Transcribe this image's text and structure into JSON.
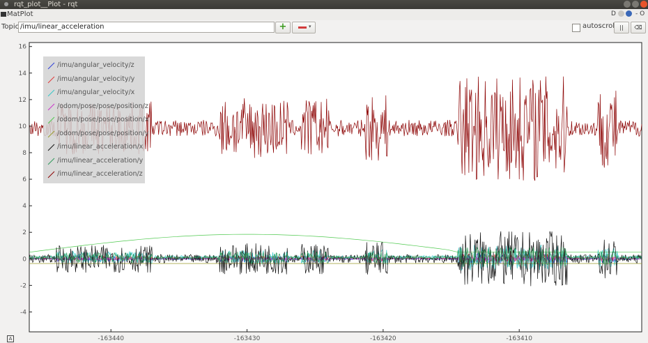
{
  "window": {
    "title": "rqt_plot__Plot - rqt"
  },
  "menubar": {
    "title": "MatPlot",
    "right_glyphs": "D",
    "right_dash": "- O"
  },
  "toolbar": {
    "topic_label": "Topic",
    "topic_value": "/imu/linear_acceleration",
    "add_label": "+",
    "remove_caret": "▾",
    "autoscroll_label": "autoscroll",
    "pause_label": "||",
    "clear_label": "⌫"
  },
  "chart_data": {
    "type": "line",
    "y_ticks": [
      "16",
      "14",
      "12",
      "10",
      "8",
      "6",
      "4",
      "2",
      "0",
      "-2",
      "-4"
    ],
    "x_ticks": [
      "-163440",
      "-163430",
      "-163420",
      "-163410"
    ],
    "xlim": [
      -163446,
      -163401
    ],
    "ylim": [
      -5.5,
      16.3
    ],
    "grid": false,
    "legend_position": "top-left",
    "series": [
      {
        "name": "/imu/angular_velocity/z",
        "color": "#2f3fd9",
        "baseline": 0.0,
        "amplitude": 0.25
      },
      {
        "name": "/imu/angular_velocity/y",
        "color": "#e23a3a",
        "baseline": 0.05,
        "amplitude": 0.2
      },
      {
        "name": "/imu/angular_velocity/x",
        "color": "#36c8c8",
        "baseline": 0.1,
        "amplitude": 0.6
      },
      {
        "name": "/odom/pose/pose/position/z",
        "color": "#cc33cc",
        "baseline": 0.0,
        "amplitude": 0.1
      },
      {
        "name": "/odom/pose/pose/position/x",
        "color": "#4ec94e",
        "baseline": 0.4,
        "amplitude": 0.0
      },
      {
        "name": "/odom/pose/pose/position/y",
        "color": "#9a9a2a",
        "baseline": -0.35,
        "amplitude": 0.0
      },
      {
        "name": "/imu/linear_acceleration/x",
        "color": "#111111",
        "baseline": 0.0,
        "amplitude": 1.3
      },
      {
        "name": "/imu/linear_acceleration/y",
        "color": "#2f9a5a",
        "baseline": 0.1,
        "amplitude": 0.5
      },
      {
        "name": "/imu/linear_acceleration/z",
        "color": "#8b0000",
        "baseline": 9.85,
        "amplitude": 2.5
      }
    ]
  },
  "legend": {
    "items": [
      {
        "label": "/imu/angular_velocity/z",
        "color": "#2f3fd9"
      },
      {
        "label": "/imu/angular_velocity/y",
        "color": "#e23a3a"
      },
      {
        "label": "/imu/angular_velocity/x",
        "color": "#36c8c8"
      },
      {
        "label": "/odom/pose/pose/position/z",
        "color": "#cc33cc"
      },
      {
        "label": "/odom/pose/pose/position/x",
        "color": "#4ec94e"
      },
      {
        "label": "/odom/pose/pose/position/y",
        "color": "#9a9a2a"
      },
      {
        "label": "/imu/linear_acceleration/x",
        "color": "#111111"
      },
      {
        "label": "/imu/linear_acceleration/y",
        "color": "#2f9a5a"
      },
      {
        "label": "/imu/linear_acceleration/z",
        "color": "#8b0000"
      }
    ]
  },
  "statusbar": {
    "corner_glyph": "A"
  }
}
